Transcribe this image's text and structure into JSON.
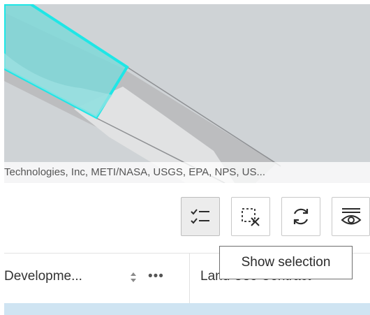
{
  "map": {
    "attribution": "Technologies, Inc, METI/NASA, USGS, EPA, NPS, US...",
    "colors": {
      "background": "#cfd3d6",
      "selection_outline": "#1fe6e6",
      "selection_fill": "#7fd8d8",
      "road_band": "#bcbdbf",
      "highlight_band": "#e1e2e3"
    }
  },
  "toolbar": {
    "buttons": [
      {
        "name": "show-selection",
        "icon": "checklist-icon",
        "active": true
      },
      {
        "name": "clear-selection",
        "icon": "selection-clear-icon",
        "active": false
      },
      {
        "name": "refresh",
        "icon": "refresh-icon",
        "active": false
      },
      {
        "name": "toggle-columns",
        "icon": "eye-list-icon",
        "active": false
      }
    ],
    "tooltip": "Show selection"
  },
  "table": {
    "columns": [
      {
        "label": "Developme...",
        "sort_icon": "sort-icon",
        "menu_icon": "more-icon"
      },
      {
        "label": "Land Use Contract"
      }
    ],
    "more_glyph": "•••",
    "selected_row_color": "#cfe4f2"
  }
}
